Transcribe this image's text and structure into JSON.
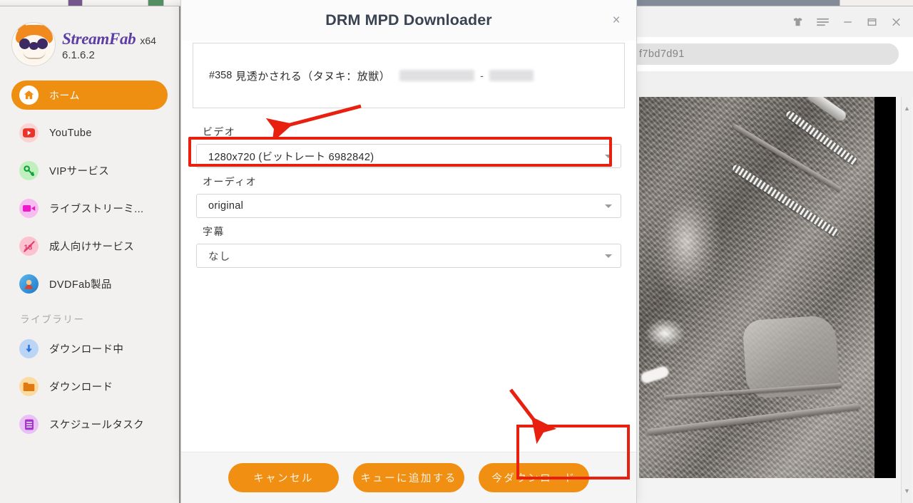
{
  "taskbar": {
    "present": true
  },
  "sidebar": {
    "brand": {
      "name": "StreamFab",
      "arch": "x64",
      "version": "6.1.6.2",
      "logo_icon": "streamfab-mascot-icon"
    },
    "items": [
      {
        "label": "ホーム",
        "icon": "home-icon",
        "active": true
      },
      {
        "label": "YouTube",
        "icon": "youtube-icon",
        "active": false
      },
      {
        "label": "VIPサービス",
        "icon": "key-icon",
        "active": false
      },
      {
        "label": "ライブストリーミ...",
        "icon": "video-camera-icon",
        "active": false
      },
      {
        "label": "成人向けサービス",
        "icon": "adult-blocked-icon",
        "active": false
      },
      {
        "label": "DVDFab製品",
        "icon": "dvdfab-icon",
        "active": false
      }
    ],
    "library_section_title": "ライブラリー",
    "library_items": [
      {
        "label": "ダウンロード中",
        "icon": "download-arrow-icon"
      },
      {
        "label": "ダウンロード",
        "icon": "folder-icon"
      },
      {
        "label": "スケジュールタスク",
        "icon": "schedule-list-icon"
      }
    ]
  },
  "dialog": {
    "title": "DRM MPD Downloader",
    "close_label": "×",
    "close_icon": "close-icon",
    "info": {
      "number": "#358",
      "japanese_title": "見透かされる（タヌキ：放獣）",
      "separator": "-",
      "redacted_1": "",
      "redacted_2": ""
    },
    "fields": [
      {
        "label": "ビデオ",
        "value": "1280x720 (ビットレート 6982842)",
        "highlighted": true,
        "name": "video-quality-select"
      },
      {
        "label": "オーディオ",
        "value": "original",
        "highlighted": false,
        "name": "audio-track-select"
      },
      {
        "label": "字幕",
        "value": "なし",
        "highlighted": false,
        "name": "subtitle-select"
      }
    ],
    "buttons": {
      "cancel": "キャンセル",
      "add_to_queue": "キューに追加する",
      "download_now": "今ダウンロード"
    }
  },
  "background_window": {
    "url_text": "f7bd7d91",
    "window_controls": [
      {
        "icon": "theme-shirt-icon",
        "label": ""
      },
      {
        "icon": "hamburger-menu-icon",
        "label": ""
      },
      {
        "icon": "minimize-icon",
        "label": "−"
      },
      {
        "icon": "maximize-icon",
        "label": ""
      },
      {
        "icon": "close-icon",
        "label": "✕"
      }
    ],
    "preview_image_alt": "grayscale-trail-camera-photo-raccoon-dog"
  },
  "annotations": {
    "arrow_to_video_field": "red-arrow-icon",
    "arrow_to_download_button": "red-arrow-icon",
    "highlight_color": "#e8200f"
  },
  "colors": {
    "accent_orange": "#f08f11",
    "brand_purple": "#5d3fa3",
    "annotation_red": "#e8200f",
    "dialog_title": "#3a4352"
  }
}
